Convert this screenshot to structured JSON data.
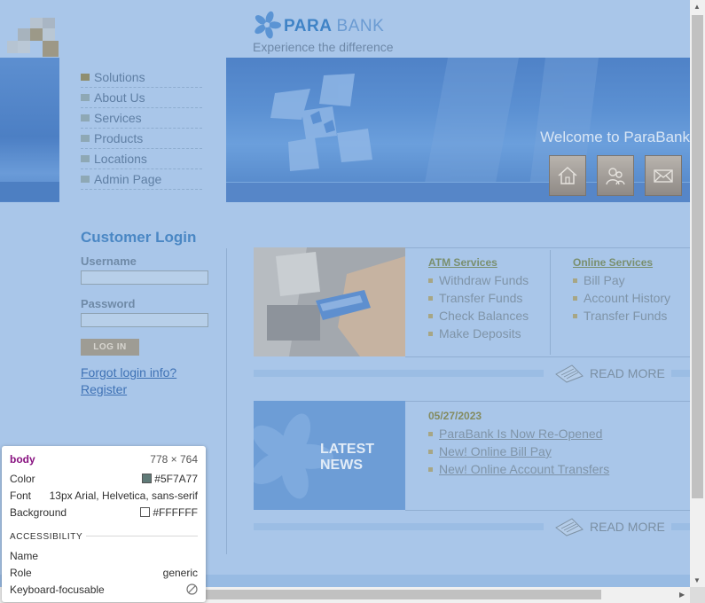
{
  "brand": {
    "name_bold": "PARA",
    "name_light": "BANK",
    "tagline": "Experience the difference"
  },
  "nav": {
    "items": [
      {
        "label": "Solutions"
      },
      {
        "label": "About Us"
      },
      {
        "label": "Services"
      },
      {
        "label": "Products"
      },
      {
        "label": "Locations"
      },
      {
        "label": "Admin Page"
      }
    ]
  },
  "banner": {
    "welcome": "Welcome to ParaBank",
    "buttons": [
      "home-icon",
      "contact-people-icon",
      "mail-icon"
    ]
  },
  "login": {
    "title": "Customer Login",
    "username_label": "Username",
    "username_value": "",
    "password_label": "Password",
    "password_value": "",
    "submit_label": "LOG IN",
    "forgot_link": "Forgot login info?",
    "register_link": "Register"
  },
  "services": {
    "atm": {
      "heading": "ATM Services",
      "items": [
        "Withdraw Funds",
        "Transfer Funds",
        "Check Balances",
        "Make Deposits"
      ]
    },
    "online": {
      "heading": "Online Services",
      "items": [
        "Bill Pay",
        "Account History",
        "Transfer Funds"
      ]
    },
    "read_more": "READ MORE"
  },
  "news": {
    "image_label_line1": "LATEST",
    "image_label_line2": "NEWS",
    "date": "05/27/2023",
    "items": [
      "ParaBank Is Now Re-Opened",
      "New! Online Bill Pay",
      "New! Online Account Transfers"
    ],
    "read_more": "READ MORE"
  },
  "devtools_tooltip": {
    "tag": "body",
    "size": "778 × 764",
    "color_label": "Color",
    "color_value": "#5F7A77",
    "font_label": "Font",
    "font_value": "13px Arial, Helvetica, sans-serif",
    "background_label": "Background",
    "background_value": "#FFFFFF",
    "section": "ACCESSIBILITY",
    "name_label": "Name",
    "name_value": "",
    "role_label": "Role",
    "role_value": "generic",
    "focus_label": "Keyboard-focusable",
    "focus_icon": "not-allowed-icon"
  },
  "colors": {
    "page_bg": "#a9c6e9",
    "banner": "#5b90d2",
    "accent_blue": "#4a87c4"
  }
}
